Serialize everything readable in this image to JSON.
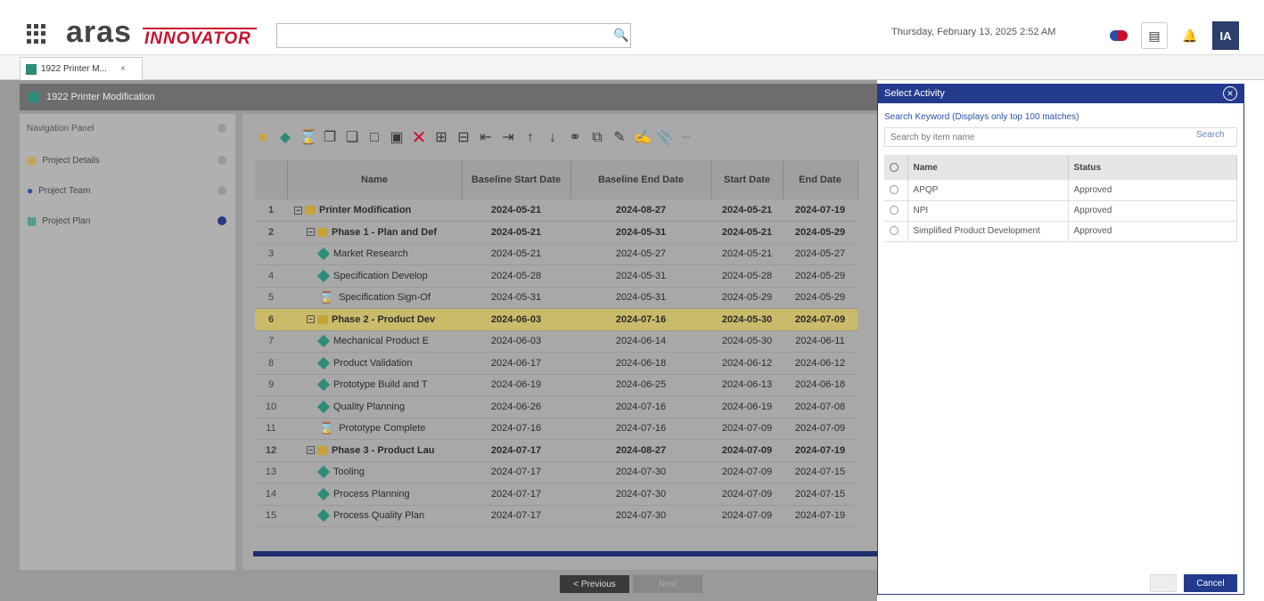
{
  "header": {
    "logo_main": "aras",
    "logo_sub": "INNOVATOR",
    "search_placeholder": "",
    "datetime": "Thursday, February 13, 2025 2:52 AM",
    "avatar_initials": "IA"
  },
  "tabs": [
    {
      "label": "1922 Printer M...",
      "close": "×"
    }
  ],
  "item_title": "1922 Printer Modification",
  "nav": {
    "header": "Navigation Panel",
    "items": [
      {
        "label": "Project Details",
        "icon": "details-icon"
      },
      {
        "label": "Project Team",
        "icon": "team-icon"
      },
      {
        "label": "Project Plan",
        "icon": "plan-icon",
        "active": true
      }
    ]
  },
  "grid": {
    "columns": [
      "Name",
      "Baseline Start Date",
      "Baseline End Date",
      "Start Date",
      "End Date"
    ],
    "rows": [
      {
        "n": "1",
        "name": "Printer Modification",
        "type": "folder",
        "level": 0,
        "bs": "2024-05-21",
        "be": "2024-08-27",
        "s": "2024-05-21",
        "e": "2024-07-19",
        "summary": true
      },
      {
        "n": "2",
        "name": "Phase 1 - Plan and Def",
        "type": "folder",
        "level": 1,
        "bs": "2024-05-21",
        "be": "2024-05-31",
        "s": "2024-05-21",
        "e": "2024-05-29",
        "summary": true
      },
      {
        "n": "3",
        "name": "Market Research",
        "type": "task",
        "level": 2,
        "bs": "2024-05-21",
        "be": "2024-05-27",
        "s": "2024-05-21",
        "e": "2024-05-27"
      },
      {
        "n": "4",
        "name": "Specification Develop",
        "type": "task",
        "level": 2,
        "bs": "2024-05-28",
        "be": "2024-05-31",
        "s": "2024-05-28",
        "e": "2024-05-29"
      },
      {
        "n": "5",
        "name": "Specification Sign-Of",
        "type": "milestone",
        "level": 2,
        "bs": "2024-05-31",
        "be": "2024-05-31",
        "s": "2024-05-29",
        "e": "2024-05-29"
      },
      {
        "n": "6",
        "name": "Phase 2 - Product Dev",
        "type": "folder",
        "level": 1,
        "bs": "2024-06-03",
        "be": "2024-07-16",
        "s": "2024-05-30",
        "e": "2024-07-09",
        "summary": true,
        "highlight": true
      },
      {
        "n": "7",
        "name": "Mechanical Product E",
        "type": "task",
        "level": 2,
        "bs": "2024-06-03",
        "be": "2024-06-14",
        "s": "2024-05-30",
        "e": "2024-06-11"
      },
      {
        "n": "8",
        "name": "Product Validation",
        "type": "task",
        "level": 2,
        "bs": "2024-06-17",
        "be": "2024-06-18",
        "s": "2024-06-12",
        "e": "2024-06-12"
      },
      {
        "n": "9",
        "name": "Prototype Build and T",
        "type": "task",
        "level": 2,
        "bs": "2024-06-19",
        "be": "2024-06-25",
        "s": "2024-06-13",
        "e": "2024-06-18"
      },
      {
        "n": "10",
        "name": "Quality Planning",
        "type": "task",
        "level": 2,
        "bs": "2024-06-26",
        "be": "2024-07-16",
        "s": "2024-06-19",
        "e": "2024-07-08"
      },
      {
        "n": "11",
        "name": "Prototype Complete",
        "type": "milestone",
        "level": 2,
        "bs": "2024-07-16",
        "be": "2024-07-16",
        "s": "2024-07-09",
        "e": "2024-07-09"
      },
      {
        "n": "12",
        "name": "Phase 3 - Product Lau",
        "type": "folder",
        "level": 1,
        "bs": "2024-07-17",
        "be": "2024-08-27",
        "s": "2024-07-09",
        "e": "2024-07-19",
        "summary": true
      },
      {
        "n": "13",
        "name": "Tooling",
        "type": "task",
        "level": 2,
        "bs": "2024-07-17",
        "be": "2024-07-30",
        "s": "2024-07-09",
        "e": "2024-07-15"
      },
      {
        "n": "14",
        "name": "Process Planning",
        "type": "task",
        "level": 2,
        "bs": "2024-07-17",
        "be": "2024-07-30",
        "s": "2024-07-09",
        "e": "2024-07-15"
      },
      {
        "n": "15",
        "name": "Process Quality Plan",
        "type": "task",
        "level": 2,
        "bs": "2024-07-17",
        "be": "2024-07-30",
        "s": "2024-07-09",
        "e": "2024-07-19"
      }
    ]
  },
  "footer": {
    "prev_label": "< Previous",
    "next_label": "Next"
  },
  "dialog": {
    "title": "Select Activity",
    "hint": "Search Keyword (Displays only top 100 matches)",
    "search_placeholder": "Search by item name",
    "search_button": "Search",
    "columns": [
      "Name",
      "Status"
    ],
    "rows": [
      {
        "name": "APQP",
        "status": "Approved"
      },
      {
        "name": "NPI",
        "status": "Approved"
      },
      {
        "name": "Simplified Product Development",
        "status": "Approved"
      }
    ],
    "ok_label": "",
    "cancel_label": "Cancel"
  }
}
